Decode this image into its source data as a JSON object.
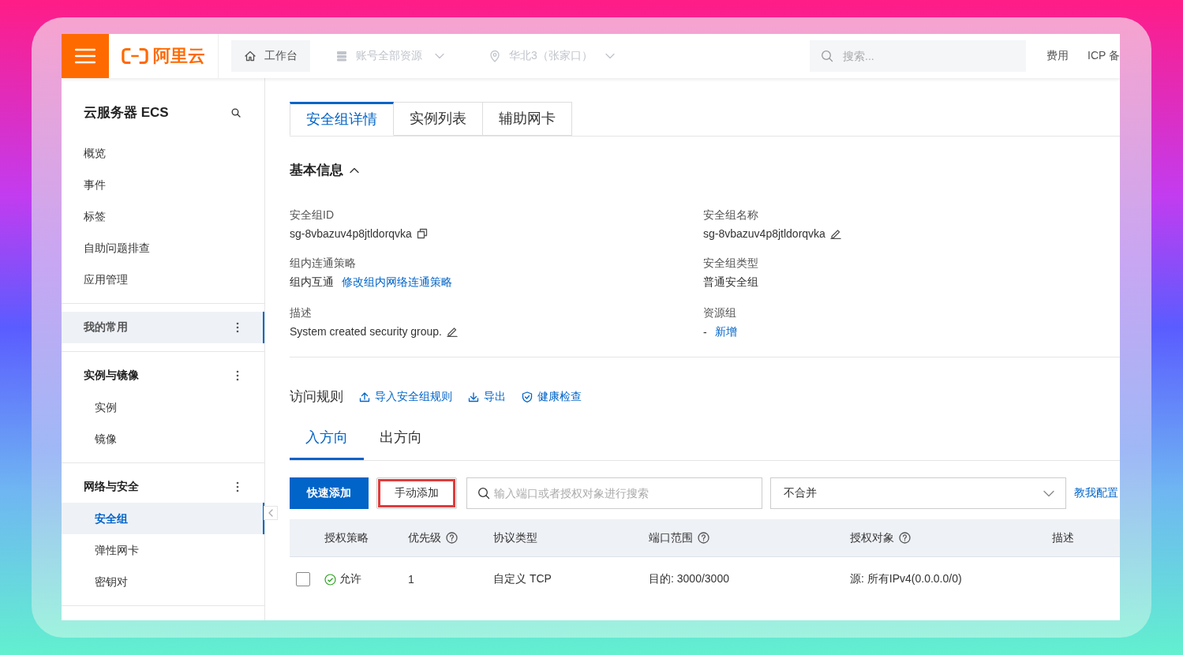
{
  "header": {
    "logo_text": "阿里云",
    "nav": [
      {
        "label": "工作台",
        "kind": "home",
        "disabled": false
      },
      {
        "label": "账号全部资源",
        "kind": "resources",
        "disabled": true
      },
      {
        "label": "华北3（张家口）",
        "kind": "region",
        "disabled": true
      }
    ],
    "search": {
      "placeholder": "搜索..."
    },
    "links": [
      "费用",
      "ICP 备"
    ]
  },
  "sidebar": {
    "title": "云服务器 ECS",
    "items": [
      {
        "label": "概览",
        "selected": false
      },
      {
        "label": "事件",
        "selected": false
      },
      {
        "label": "标签",
        "selected": false
      },
      {
        "label": "自助问题排查",
        "selected": false
      },
      {
        "label": "应用管理",
        "selected": false
      }
    ],
    "groups": [
      {
        "label": "我的常用",
        "active": true
      },
      {
        "label": "实例与镜像",
        "active": false,
        "items": [
          {
            "label": "实例",
            "selected": false
          },
          {
            "label": "镜像",
            "selected": false
          }
        ]
      },
      {
        "label": "网络与安全",
        "active": false,
        "items": [
          {
            "label": "安全组",
            "selected": true
          },
          {
            "label": "弹性网卡",
            "selected": false
          },
          {
            "label": "密钥对",
            "selected": false
          }
        ]
      }
    ]
  },
  "tabs": [
    {
      "label": "安全组详情",
      "selected": true
    },
    {
      "label": "实例列表",
      "selected": false
    },
    {
      "label": "辅助网卡",
      "selected": false
    }
  ],
  "basic_info": {
    "title": "基本信息",
    "expanded": true,
    "fields": [
      {
        "label": "安全组ID",
        "value": "sg-8vbazuv4p8jtldorqvka",
        "kind": "copy"
      },
      {
        "label": "安全组名称",
        "value": "sg-8vbazuv4p8jtldorqvka",
        "kind": "edit"
      },
      {
        "label": "组内连通策略",
        "value": "组内互通",
        "link": "修改组内网络连通策略"
      },
      {
        "label": "安全组类型",
        "value": "普通安全组"
      },
      {
        "label": "描述",
        "value": "System created security group.",
        "kind": "edit"
      },
      {
        "label": "资源组",
        "value": "-",
        "link": "新增"
      }
    ]
  },
  "access_rules": {
    "title": "访问规则",
    "actions": [
      "导入安全组规则",
      "导出",
      "健康检查"
    ],
    "direction_tabs": [
      {
        "label": "入方向",
        "selected": true
      },
      {
        "label": "出方向",
        "selected": false
      }
    ],
    "buttons": [
      {
        "label": "快速添加",
        "kind": "primary",
        "highlighted": false
      },
      {
        "label": "手动添加",
        "kind": "default",
        "highlighted": true
      }
    ],
    "search": {
      "placeholder": "输入端口或者授权对象进行搜索"
    },
    "merge_select": {
      "value": "不合并"
    },
    "help_link": "教我配置",
    "table": {
      "columns": [
        {
          "label": "授权策略",
          "help": false
        },
        {
          "label": "优先级",
          "help": true
        },
        {
          "label": "协议类型",
          "help": false
        },
        {
          "label": "端口范围",
          "help": true
        },
        {
          "label": "授权对象",
          "help": true
        },
        {
          "label": "描述",
          "help": false
        }
      ],
      "rows": [
        {
          "checked": false,
          "cells": [
            "允许",
            "1",
            "自定义 TCP",
            "目的: 3000/3000",
            "源: 所有IPv4(0.0.0.0/0)"
          ]
        }
      ]
    }
  }
}
